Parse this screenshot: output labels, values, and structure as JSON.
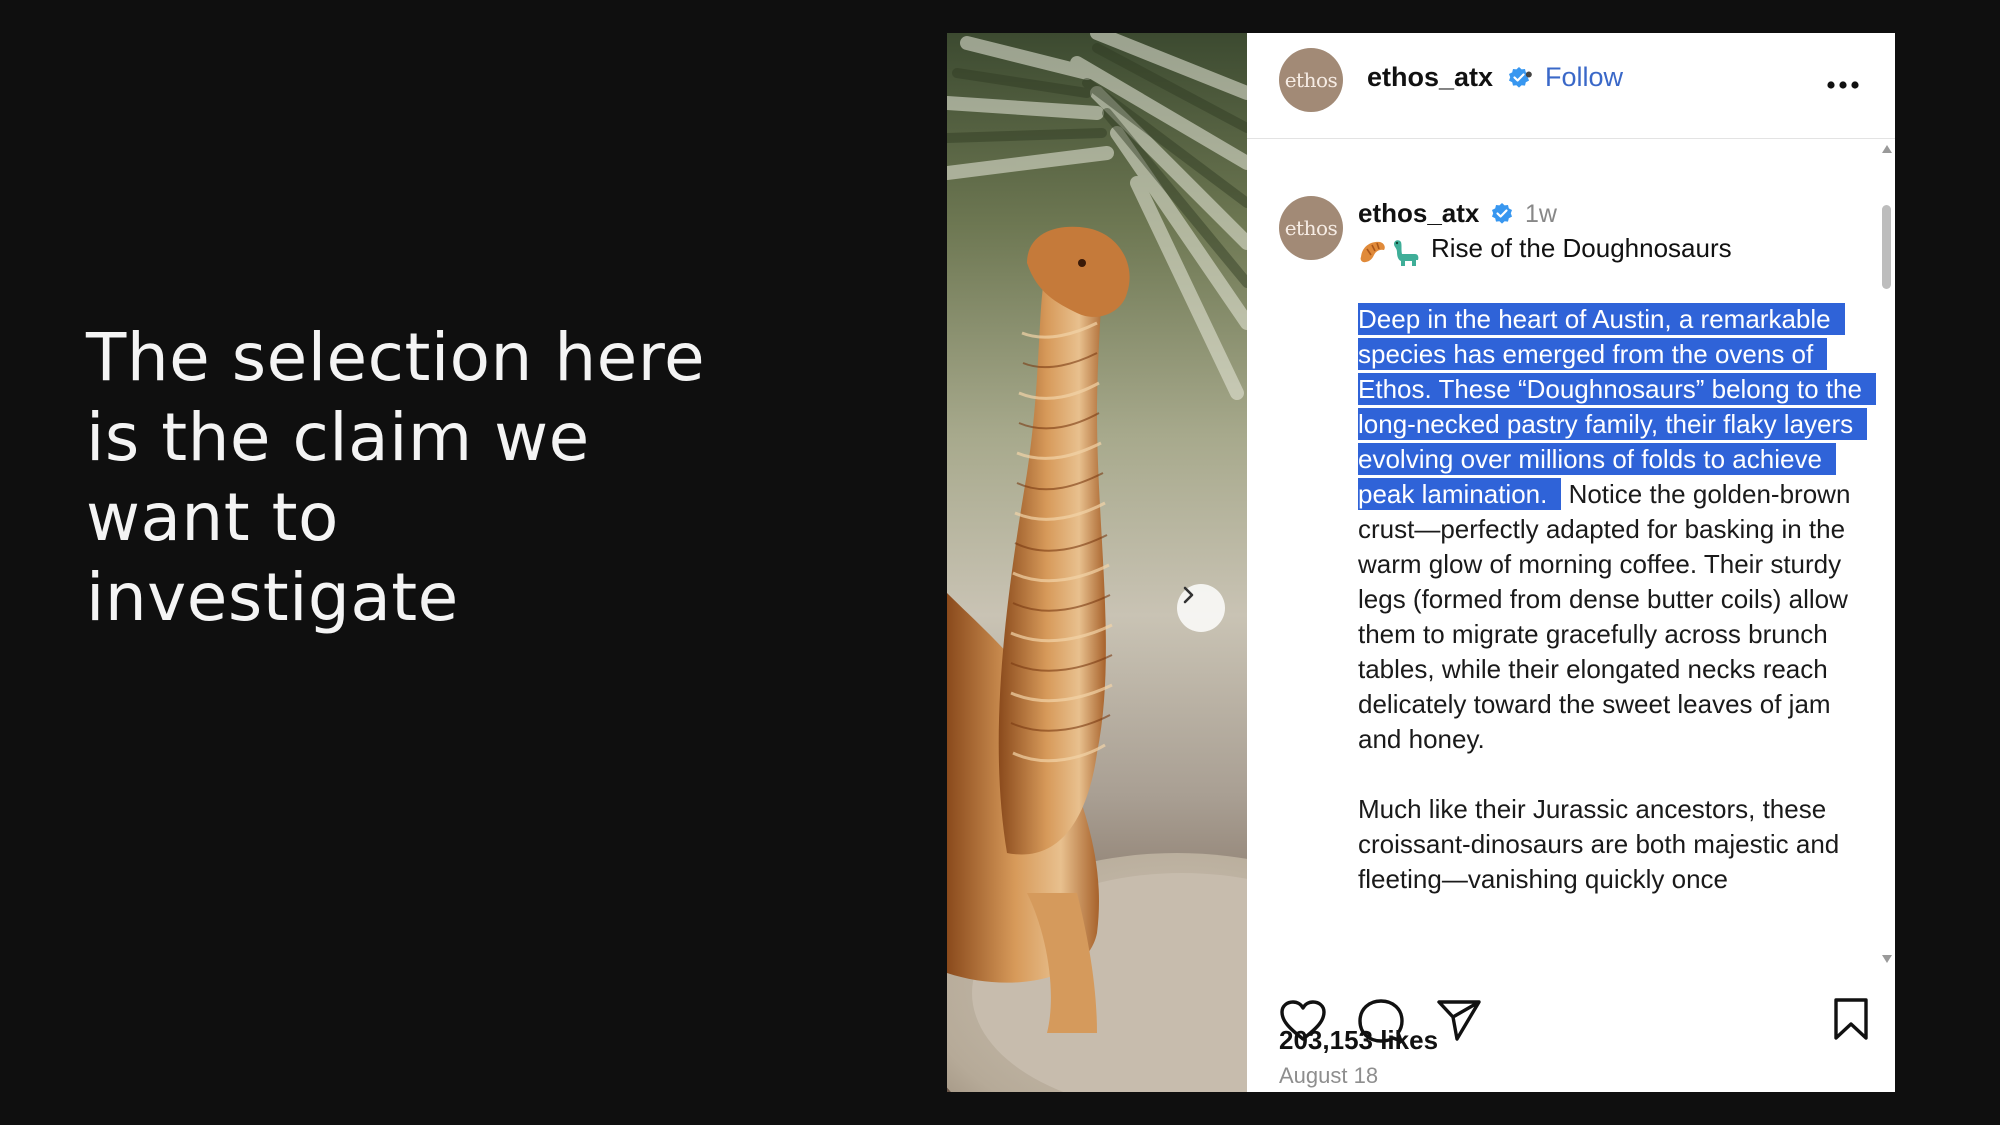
{
  "slide": {
    "heading": "The selection here is the claim we want to investigate"
  },
  "post": {
    "account": {
      "avatar_text": "ethos",
      "username": "ethos_atx",
      "verified": true,
      "follow_label": "Follow",
      "separator": "•"
    },
    "caption_block": {
      "username": "ethos_atx",
      "time": "1w",
      "emojis": [
        "croissant",
        "sauropod"
      ],
      "title": "Rise of the Doughnosaurs",
      "highlighted_text": "Deep in the heart of Austin, a remarkable species has emerged from the ovens of Ethos. These “Doughnosaurs” belong to the long-necked pastry family, their flaky layers evolving over millions of folds to achieve peak lamination.",
      "after_highlight_text": " Notice the golden-brown crust—perfectly adapted for basking in the warm glow of morning coffee. Their sturdy legs (formed from dense butter coils) allow them to migrate gracefully across brunch tables, while their elongated necks reach delicately toward the sweet leaves of jam and honey.",
      "paragraph_2": "Much like their Jurassic ancestors, these croissant-dinosaurs are both majestic and fleeting—vanishing quickly once"
    },
    "actions": {
      "icons": [
        "heart-icon",
        "comment-icon",
        "share-icon",
        "bookmark-icon"
      ]
    },
    "likes": "203,153 likes",
    "date": "August 18"
  },
  "colors": {
    "slide_background": "#0f0f0f",
    "heading_text": "#f4f4f4",
    "selection": "#2f63d8",
    "follow_link": "#3a68c8",
    "verified_badge": "#3897f0",
    "avatar": "#a28a76"
  }
}
